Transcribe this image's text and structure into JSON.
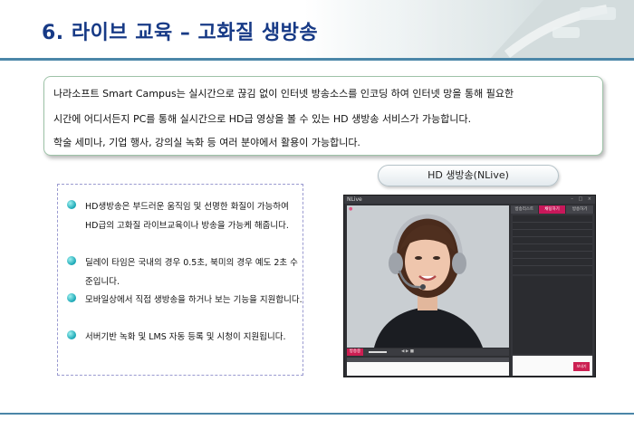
{
  "header": {
    "title": "6. 라이브 교육 – 고화질 생방송"
  },
  "intro": {
    "lines": [
      "나라소프트 Smart Campus는 실시간으로 끊김 없이 인터넷 방송소스를 인코딩 하여 인터넷 망을 통해 필요한",
      "시간에 어디서든지 PC를 통해 실시간으로 HD급 영상을 볼 수 있는 HD 생방송 서비스가 가능합니다.",
      "학술 세미나, 기업 행사, 강의실 녹화 등 여러 분야에서 활용이 가능합니다."
    ]
  },
  "hd_label": "HD 생방송(NLive)",
  "bullets": [
    "HD생방송은 부드러운 움직임 및 선명한 화질이 가능하여 HD급의 고화질 라이브교육이나 방송을 가능케 해줍니다.",
    "딜레이 타임은 국내의 경우 0.5초, 북미의 경우 예도 2초 수준입니다.",
    "모바일상에서 직접 생방송을 하거나 보는 기능을 지원합니다.",
    "서버기반 녹화 및 LMS 자동 등록 및 시청이 지원됩니다."
  ],
  "app": {
    "logo": "NLive",
    "tabs": [
      "방송리스트",
      "채팅하기",
      "방송하기"
    ],
    "rec_label": "방송중",
    "send_label": "보내기"
  },
  "colors": {
    "title": "#173a86",
    "accent": "#c8175a",
    "rule": "#4b86a8",
    "bullet": "#17a6b4"
  }
}
